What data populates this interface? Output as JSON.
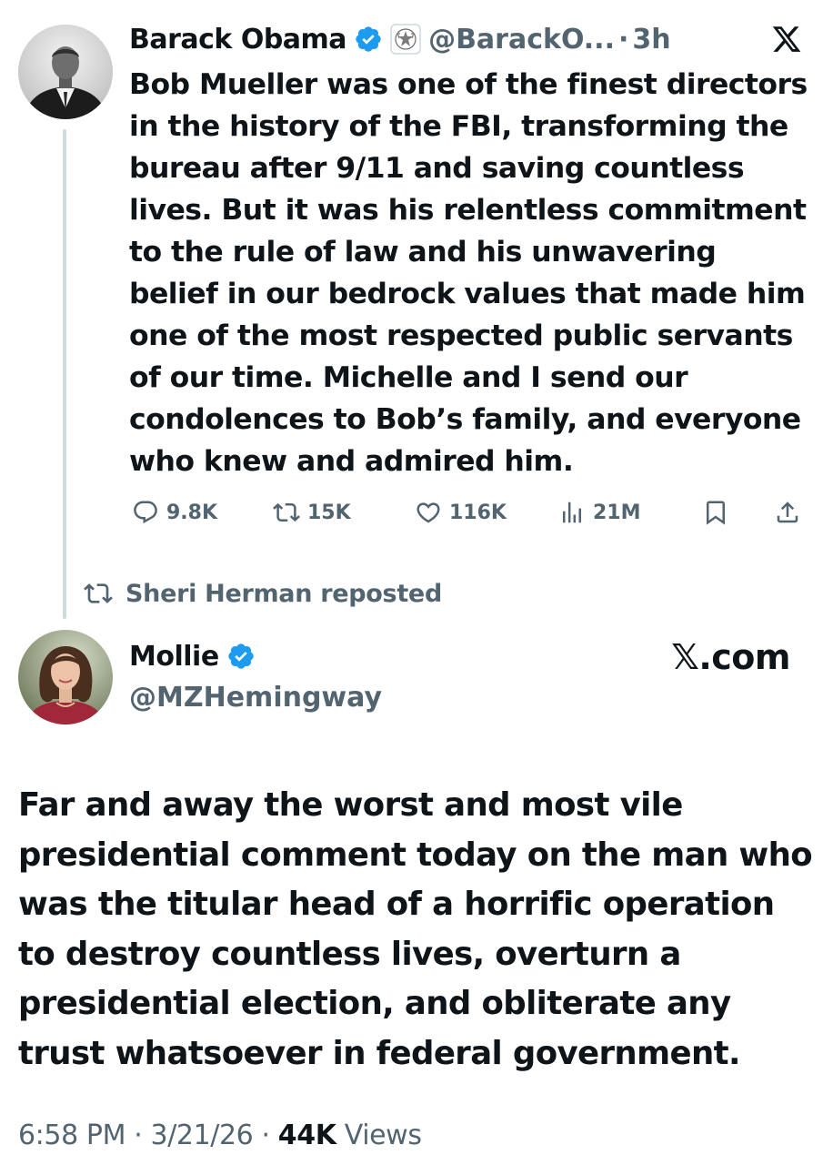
{
  "main_tweet": {
    "author_name": "Barack Obama",
    "handle": "@BarackO...",
    "separator": "·",
    "time": "3h",
    "text": "Bob Mueller was one of the finest directors in the history of the FBI, transforming the bureau after 9/11 and saving countless lives. But it was his relentless commitment to the rule of law and his unwavering belief in our bedrock values that made him one of the most respected public servants of our time. Michelle and I send our condolences to Bob’s family, and everyone who knew and admired him.",
    "actions": {
      "replies": "9.8K",
      "reposts": "15K",
      "likes": "116K",
      "views": "21M"
    },
    "icons": [
      "verified-badge-icon",
      "presidential-seal-icon",
      "x-logo-icon",
      "reply-icon",
      "repost-icon",
      "like-icon",
      "views-icon",
      "bookmark-icon",
      "share-icon"
    ]
  },
  "repost_indicator": {
    "text": "Sheri Herman reposted"
  },
  "quote_tweet": {
    "author_name": "Mollie",
    "handle": "@MZHemingway",
    "brand": "𝕏.com",
    "text": "Far and away the worst and most vile presidential comment today on the man who was the titular head of a horrific operation to destroy countless lives, overturn a presidential election, and obliterate any trust whatsoever in federal government.",
    "time": "6:58 PM",
    "date": "3/21/26",
    "separator": " · ",
    "views_count": "44K",
    "views_label": " Views"
  },
  "colors": {
    "text": "#0f1419",
    "secondary": "#536471",
    "verified": "#1d9bf0",
    "thread_line": "#cfd9de"
  }
}
